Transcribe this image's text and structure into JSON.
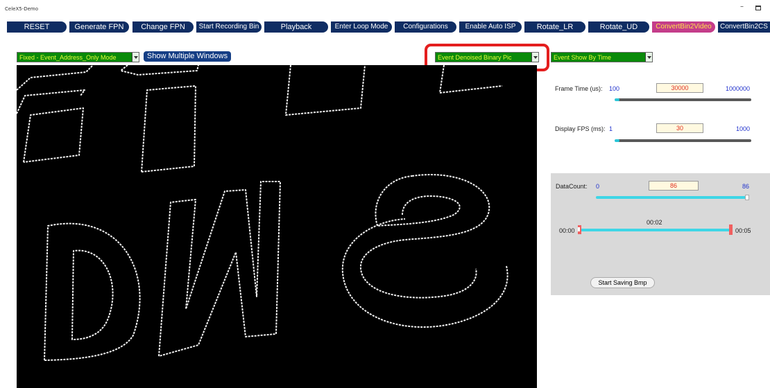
{
  "window": {
    "title": "CeleX5-Demo",
    "min_glyph": "–"
  },
  "toolbar": {
    "buttons": [
      {
        "label": "RESET"
      },
      {
        "label": "Generate FPN"
      },
      {
        "label": "Change FPN"
      },
      {
        "label": "Start Recording Bin"
      },
      {
        "label": "Playback"
      },
      {
        "label": "Enter Loop Mode"
      },
      {
        "label": "Configurations"
      },
      {
        "label": "Enable Auto ISP"
      },
      {
        "label": "Rotate_LR"
      },
      {
        "label": "Rotate_UD"
      },
      {
        "label": "ConvertBin2Video"
      },
      {
        "label": "ConvertBin2CS"
      }
    ]
  },
  "controls": {
    "mode_select": "Fixed - Event_Address_Only Mode",
    "show_multiple_windows": "Show Multiple Windows",
    "picture_type_select": "Event Denoised Binary Pic",
    "show_by_select": "Event Show By Time"
  },
  "settings": {
    "frame_time": {
      "label": "Frame Time (us):",
      "min": "100",
      "value": "30000",
      "max": "1000000",
      "position": 0.03
    },
    "display_fps": {
      "label": "Display FPS (ms):",
      "min": "1",
      "value": "30",
      "max": "1000",
      "position": 0.03
    }
  },
  "playback": {
    "datacount": {
      "label": "DataCount:",
      "min": "0",
      "value": "86",
      "max": "86",
      "position": 1.0
    },
    "time_start": "00:00",
    "time_current": "00:02",
    "time_end": "00:05",
    "save_bmp_button": "Start Saving Bmp"
  },
  "colors": {
    "toolbar_button": "#0f2d63",
    "active_button": "#c43d8a",
    "combo_bg": "#0a8a0a",
    "highlight_border": "#e41e1e",
    "slider_accent": "#3fd6e6"
  }
}
